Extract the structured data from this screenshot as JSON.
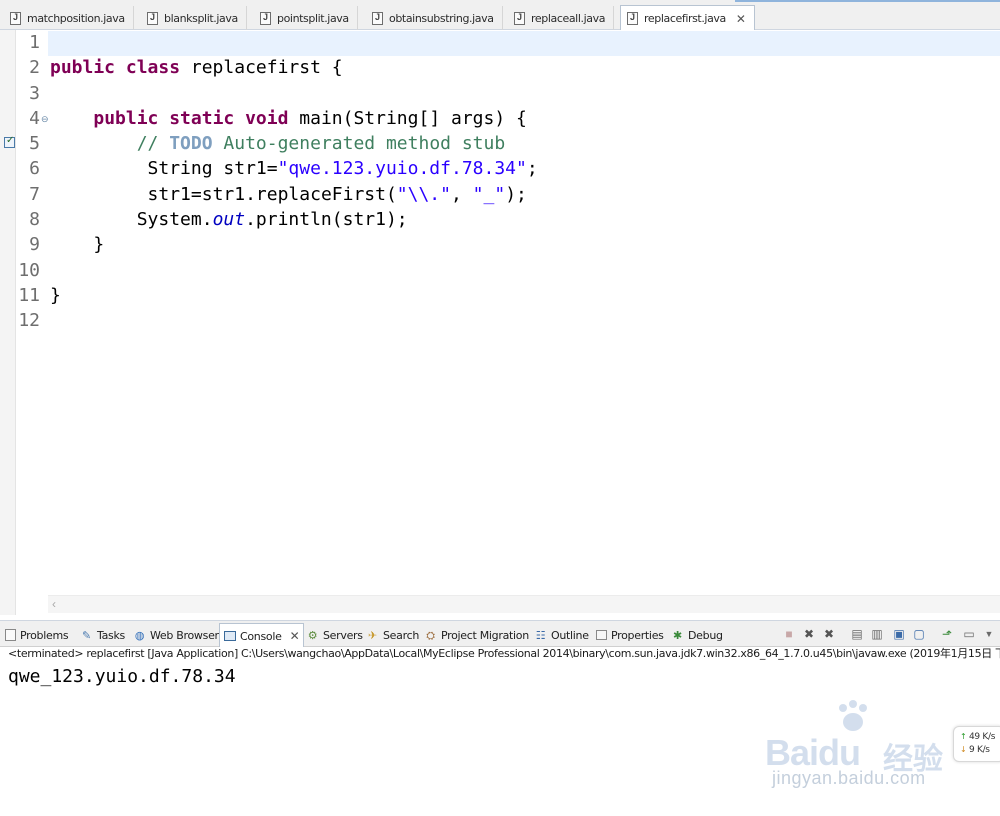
{
  "editor_tabs": [
    {
      "label": "matchposition.java"
    },
    {
      "label": "blanksplit.java"
    },
    {
      "label": "pointsplit.java"
    },
    {
      "label": "obtainsubstring.java"
    },
    {
      "label": "replaceall.java"
    },
    {
      "label": "replacefirst.java",
      "active": true
    }
  ],
  "editor": {
    "line_numbers": [
      "1",
      "2",
      "3",
      "4",
      "5",
      "6",
      "7",
      "8",
      "9",
      "10",
      "11",
      "12"
    ],
    "code": {
      "l2_kw": "public class",
      "l2_rest": " replacefirst {",
      "l4_kw": "public static void",
      "l4_rest": " main(String[] args) {",
      "l5_comment": "// ",
      "l5_todo": "TODO",
      "l5_rest": " Auto-generated method stub",
      "l6_pre": "String str1=",
      "l6_str": "\"qwe.123.yuio.df.78.34\"",
      "l6_post": ";",
      "l7_pre": "str1=str1.replaceFirst(",
      "l7_str1": "\"\\\\.\"",
      "l7_mid": ", ",
      "l7_str2": "\"_\"",
      "l7_post": ");",
      "l8_pre": "System.",
      "l8_out": "out",
      "l8_post": ".println(str1);",
      "l9": "}",
      "l11": "}"
    }
  },
  "views": {
    "tabs": [
      {
        "label": "Problems",
        "icon": "problems-icon"
      },
      {
        "label": "Tasks",
        "icon": "tasks-icon"
      },
      {
        "label": "Web Browser",
        "icon": "globe-icon"
      },
      {
        "label": "Console",
        "icon": "console-icon",
        "active": true
      },
      {
        "label": "Servers",
        "icon": "servers-icon"
      },
      {
        "label": "Search",
        "icon": "search-icon"
      },
      {
        "label": "Project Migration",
        "icon": "migration-icon"
      },
      {
        "label": "Outline",
        "icon": "outline-icon"
      },
      {
        "label": "Properties",
        "icon": "properties-icon"
      },
      {
        "label": "Debug",
        "icon": "debug-icon"
      }
    ]
  },
  "console": {
    "terminated_line": "<terminated> replacefirst [Java Application] C:\\Users\\wangchao\\AppData\\Local\\MyEclipse Professional 2014\\binary\\com.sun.java.jdk7.win32.x86_64_1.7.0.u45\\bin\\javaw.exe (2019年1月15日 下",
    "output": "qwe_123.yuio.df.78.34"
  },
  "netspeed": {
    "up_value": "49",
    "up_unit": "K/s",
    "down_value": "9",
    "down_unit": "K/s"
  },
  "watermark": {
    "brand": "Baidu",
    "sub": "经验",
    "url": "jingyan.baidu.com"
  },
  "colors": {
    "keyword": "#7f0055",
    "comment": "#3f7f5f",
    "string": "#2a00ff",
    "static_field": "#0000c0",
    "current_line": "#e8f2fe"
  }
}
